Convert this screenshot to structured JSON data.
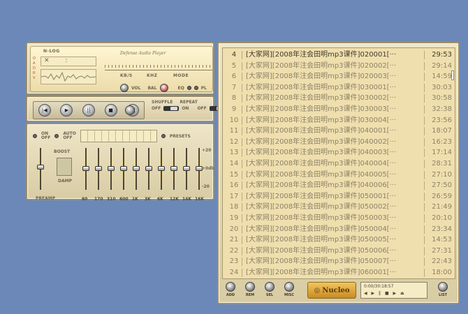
{
  "main": {
    "nlog": "N-LOG",
    "logo": "Defense Audio Player",
    "kbs": "KB/S",
    "khz": "KHZ",
    "mode": "MODE",
    "vol": "VOL",
    "bal": "BAL",
    "eq": "EQ",
    "pl": "PL"
  },
  "controls": {
    "buttons": [
      "|◀",
      "▶",
      "||",
      "■",
      "▶|"
    ],
    "shuffle": "SHUFFLE",
    "repeat": "REPEAT",
    "off": "OFF",
    "on": "ON",
    "nl": "NL"
  },
  "eq": {
    "on_off": "ON\nOFF",
    "auto": "AUTO\nOFF",
    "presets": "PRESETS",
    "boost": "BOOST",
    "damp": "DAMP",
    "db_top": "+20",
    "db_mid": "+0db",
    "db_bot": "-20",
    "preamp": "PREAMP",
    "bands": [
      "60",
      "170",
      "310",
      "600",
      "1K",
      "3K",
      "6K",
      "12K",
      "14K",
      "16K"
    ],
    "levels": [
      0.5,
      0.5,
      0.5,
      0.5,
      0.5,
      0.5,
      0.5,
      0.5,
      0.5,
      0.5
    ]
  },
  "playlist": {
    "items": [
      {
        "num": "4",
        "title": "[大家网][2008年注会田明mp3课件]020001[···",
        "dur": "29:53"
      },
      {
        "num": "5",
        "title": "[大家网][2008年注会田明mp3课件]020002[···",
        "dur": "29:14"
      },
      {
        "num": "6",
        "title": "[大家网][2008年注会田明mp3课件]020003[···",
        "dur": "14:59"
      },
      {
        "num": "7",
        "title": "[大家网][2008年注会田明mp3课件]030001[···",
        "dur": "30:03"
      },
      {
        "num": "8",
        "title": "[大家网][2008年注会田明mp3课件]030002[···",
        "dur": "30:58"
      },
      {
        "num": "9",
        "title": "[大家网][2008年注会田明mp3课件]030003[···",
        "dur": "32:38"
      },
      {
        "num": "10",
        "title": "[大家网][2008年注会田明mp3课件]030004[···",
        "dur": "23:56"
      },
      {
        "num": "11",
        "title": "[大家网][2008年注会田明mp3课件]040001[···",
        "dur": "18:07"
      },
      {
        "num": "12",
        "title": "[大家网][2008年注会田明mp3课件]040002[···",
        "dur": "16:23"
      },
      {
        "num": "13",
        "title": "[大家网][2008年注会田明mp3课件]040003[···",
        "dur": "17:14"
      },
      {
        "num": "14",
        "title": "[大家网][2008年注会田明mp3课件]040004[···",
        "dur": "28:31"
      },
      {
        "num": "15",
        "title": "[大家网][2008年注会田明mp3课件]040005[···",
        "dur": "27:10"
      },
      {
        "num": "16",
        "title": "[大家网][2008年注会田明mp3课件]040006[···",
        "dur": "27:50"
      },
      {
        "num": "17",
        "title": "[大家网][2008年注会田明mp3课件]050001[···",
        "dur": "26:59"
      },
      {
        "num": "18",
        "title": "[大家网][2008年注会田明mp3课件]050002[···",
        "dur": "21:49"
      },
      {
        "num": "19",
        "title": "[大家网][2008年注会田明mp3课件]050003[···",
        "dur": "20:10"
      },
      {
        "num": "20",
        "title": "[大家网][2008年注会田明mp3课件]050004[···",
        "dur": "23:34"
      },
      {
        "num": "21",
        "title": "[大家网][2008年注会田明mp3课件]050005[···",
        "dur": "14:53"
      },
      {
        "num": "22",
        "title": "[大家网][2008年注会田明mp3课件]050006[···",
        "dur": "27:31"
      },
      {
        "num": "23",
        "title": "[大家网][2008年注会田明mp3课件]050007[···",
        "dur": "22:43"
      },
      {
        "num": "24",
        "title": "[大家网][2008年注会田明mp3课件]060001[···",
        "dur": "18:00"
      }
    ],
    "buttons": [
      "ADD",
      "REM",
      "SEL",
      "MISC"
    ],
    "brand": "Nucleo",
    "counter": "0:00/30:18:57",
    "list": "LIST"
  }
}
